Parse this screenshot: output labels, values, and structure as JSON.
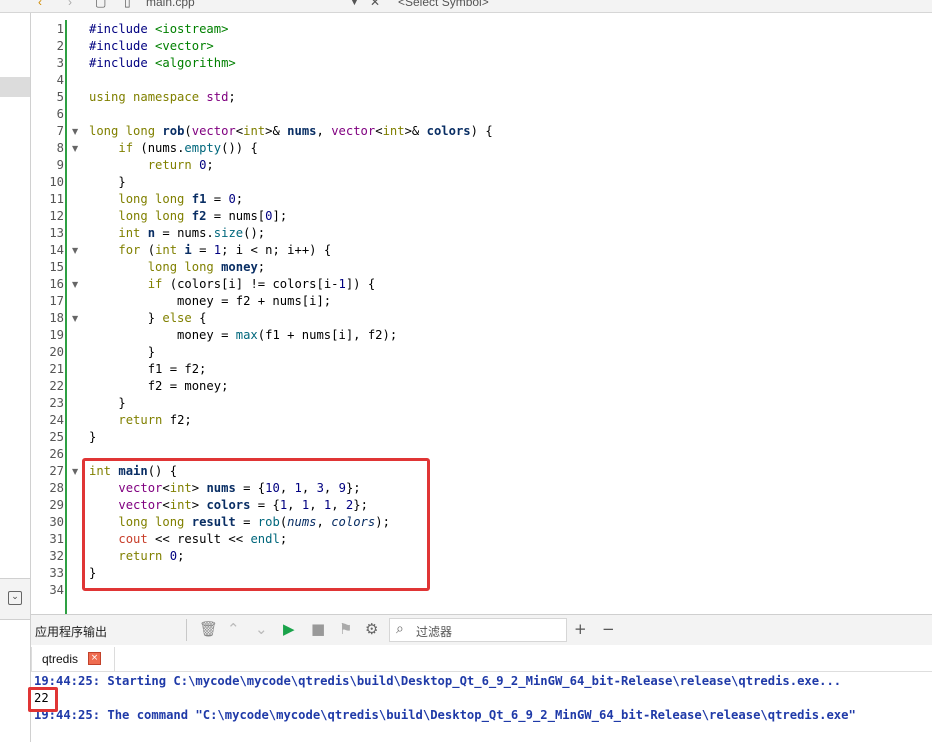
{
  "toolbar": {
    "file_name": "main.cpp",
    "symbol_placeholder": "<Select Symbol>",
    "close_glyph": "✕"
  },
  "code_lines": [
    {
      "n": "1",
      "html": "<span class='pp'>#include</span> <span class='str'>&lt;iostream&gt;</span>"
    },
    {
      "n": "2",
      "html": "<span class='pp'>#include</span> <span class='str'>&lt;vector&gt;</span>"
    },
    {
      "n": "3",
      "html": "<span class='pp'>#include</span> <span class='str'>&lt;algorithm&gt;</span>"
    },
    {
      "n": "4",
      "html": ""
    },
    {
      "n": "5",
      "html": "<span class='kw'>using namespace</span> <span class='std'>std</span>;"
    },
    {
      "n": "6",
      "html": ""
    },
    {
      "n": "7",
      "fold": true,
      "html": "<span class='kw'>long long</span> <span class='bold'>rob</span>(<span class='cls'>vector</span>&lt;<span class='kw'>int</span>&gt;&amp; <span class='bold'>nums</span>, <span class='cls'>vector</span>&lt;<span class='kw'>int</span>&gt;&amp; <span class='bold'>colors</span>) {"
    },
    {
      "n": "8",
      "fold": true,
      "html": "    <span class='kw'>if</span> (nums.<span class='fn'>empty</span>()) {"
    },
    {
      "n": "9",
      "html": "        <span class='kw'>return</span> <span class='num'>0</span>;"
    },
    {
      "n": "10",
      "html": "    }"
    },
    {
      "n": "11",
      "html": "    <span class='kw'>long long</span> <span class='bold'>f1</span> = <span class='num'>0</span>;"
    },
    {
      "n": "12",
      "html": "    <span class='kw'>long long</span> <span class='bold'>f2</span> = nums[<span class='num'>0</span>];"
    },
    {
      "n": "13",
      "html": "    <span class='kw'>int</span> <span class='bold'>n</span> = nums.<span class='fn'>size</span>();"
    },
    {
      "n": "14",
      "fold": true,
      "html": "    <span class='kw'>for</span> (<span class='kw'>int</span> <span class='bold'>i</span> = <span class='num'>1</span>; i &lt; n; i++) {"
    },
    {
      "n": "15",
      "html": "        <span class='kw'>long long</span> <span class='bold'>money</span>;"
    },
    {
      "n": "16",
      "fold": true,
      "html": "        <span class='kw'>if</span> (colors[i] != colors[i-<span class='num'>1</span>]) {"
    },
    {
      "n": "17",
      "html": "            money = f2 + nums[i];"
    },
    {
      "n": "18",
      "fold": true,
      "html": "        } <span class='kw'>else</span> {"
    },
    {
      "n": "19",
      "html": "            money = <span class='fn'>max</span>(f1 + nums[i], f2);"
    },
    {
      "n": "20",
      "html": "        }"
    },
    {
      "n": "21",
      "html": "        f1 = f2;"
    },
    {
      "n": "22",
      "html": "        f2 = money;"
    },
    {
      "n": "23",
      "html": "    }"
    },
    {
      "n": "24",
      "html": "    <span class='kw'>return</span> f2;"
    },
    {
      "n": "25",
      "html": "}"
    },
    {
      "n": "26",
      "html": ""
    },
    {
      "n": "27",
      "fold": true,
      "html": "<span class='kw'>int</span> <span class='bold'>main</span>() {"
    },
    {
      "n": "28",
      "html": "    <span class='cls'>vector</span>&lt;<span class='kw'>int</span>&gt; <span class='bold'>nums</span> = {<span class='num'>10</span>, <span class='num'>1</span>, <span class='num'>3</span>, <span class='num'>9</span>};"
    },
    {
      "n": "29",
      "html": "    <span class='cls'>vector</span>&lt;<span class='kw'>int</span>&gt; <span class='bold'>colors</span> = {<span class='num'>1</span>, <span class='num'>1</span>, <span class='num'>1</span>, <span class='num'>2</span>};"
    },
    {
      "n": "30",
      "html": "    <span class='kw'>long long</span> <span class='bold'>result</span> = <span class='fn'>rob</span>(<span class='italic'>nums</span>, <span class='italic'>colors</span>);"
    },
    {
      "n": "31",
      "html": "    <span class='fn' style='color:#c83e2a'>cout</span> &lt;&lt; result &lt;&lt; <span class='fn'>endl</span>;"
    },
    {
      "n": "32",
      "html": "    <span class='kw'>return</span> <span class='num'>0</span>;"
    },
    {
      "n": "33",
      "html": "}"
    },
    {
      "n": "34",
      "html": ""
    }
  ],
  "output_pane": {
    "title": "应用程序输出",
    "filter_placeholder": "过滤器",
    "tab_label": "qtredis",
    "lines": [
      {
        "text": "19:44:25: Starting C:\\mycode\\mycode\\qtredis\\build\\Desktop_Qt_6_9_2_MinGW_64_bit-Release\\release\\qtredis.exe...",
        "style": "bold"
      },
      {
        "text": "22",
        "style": "plain"
      },
      {
        "text": "19:44:25: The command \"C:\\mycode\\mycode\\qtredis\\build\\Desktop_Qt_6_9_2_MinGW_64_bit-Release\\release\\qtredis.exe\"",
        "style": "bold"
      }
    ]
  },
  "colors": {
    "highlight": "#e03535",
    "gutter_green": "#2ea043",
    "output_blue": "#1f3aa8"
  }
}
